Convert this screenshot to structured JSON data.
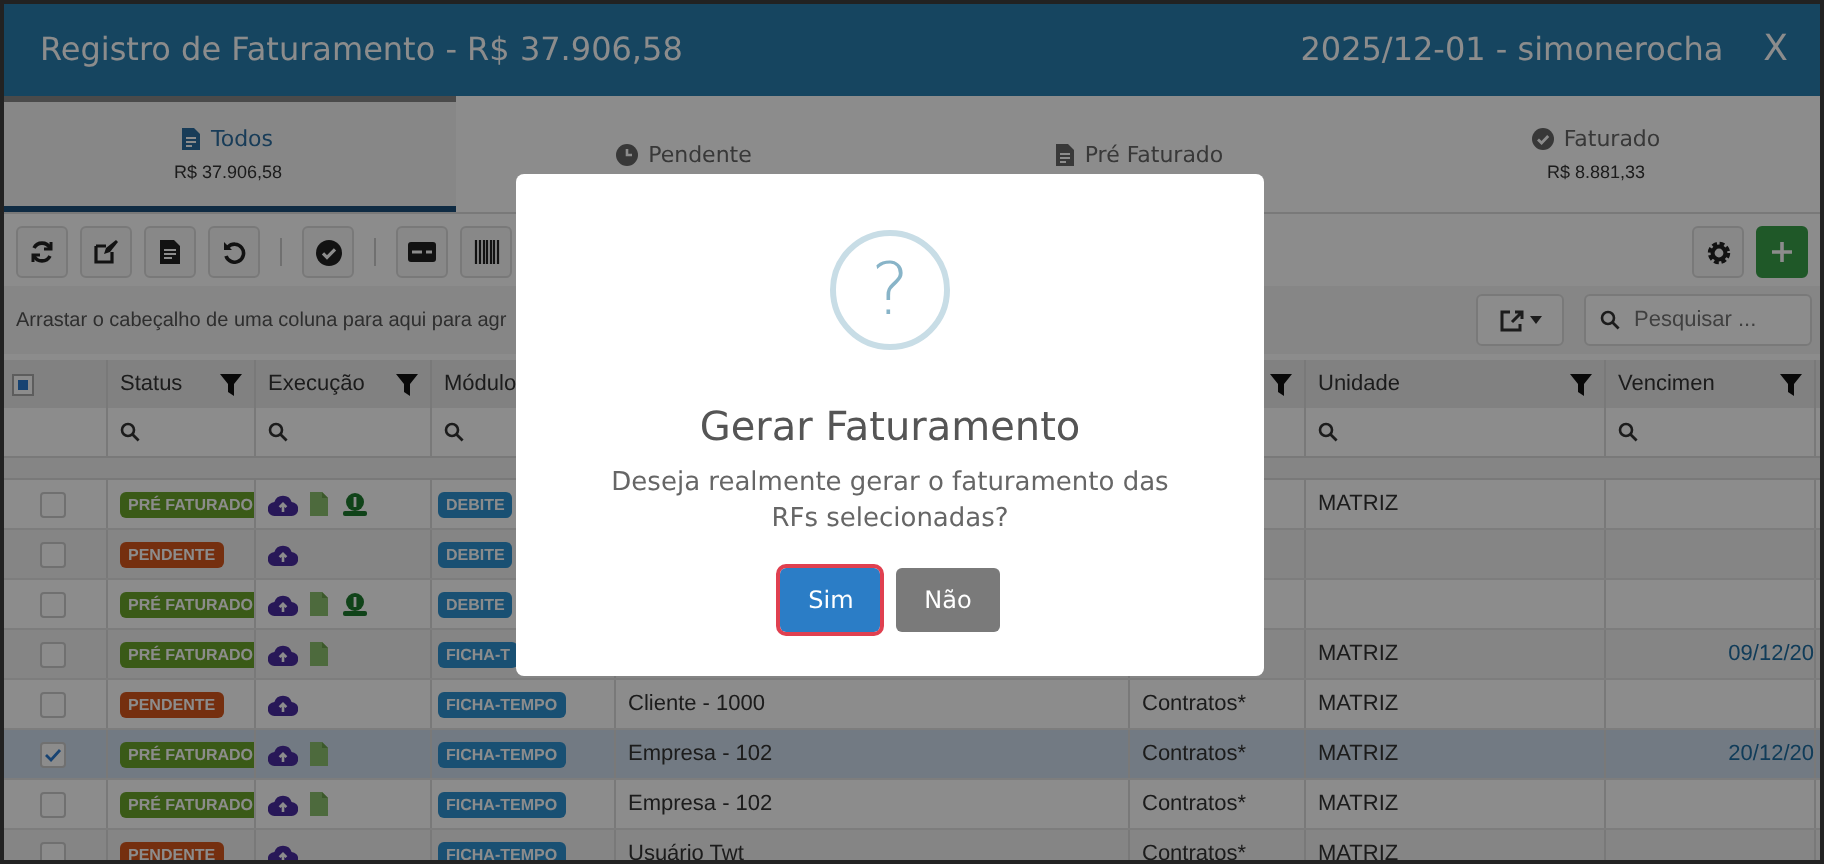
{
  "window": {
    "title": "Registro de Faturamento - R$ 37.906,58",
    "session": "2025/12-01 - simonerocha",
    "close": "X"
  },
  "tabs": [
    {
      "label": "Todos",
      "amount": "R$ 37.906,58",
      "kind": "file",
      "selected": true
    },
    {
      "label": "Pendente",
      "kind": "clock",
      "selected": false
    },
    {
      "label": "Pré Faturado",
      "kind": "file",
      "selected": false
    },
    {
      "label": "Faturado",
      "amount": "R$ 8.881,33",
      "kind": "check",
      "selected": false
    }
  ],
  "group_hint": "Arrastar o cabeçalho de uma coluna para aqui para agr",
  "search": {
    "placeholder": "Pesquisar ..."
  },
  "table": {
    "select_all_partial": true,
    "columns": [
      {
        "label": "Status",
        "filter": true,
        "search": true
      },
      {
        "label": "Execução",
        "filter": true,
        "search": true
      },
      {
        "label": "Módulo",
        "search": true
      },
      {},
      {
        "filter": true
      },
      {
        "label": "Unidade",
        "filter": true,
        "search": true
      },
      {
        "label": "Vencimen",
        "filter": true,
        "search": true
      }
    ],
    "rows": [
      {
        "checked": false,
        "selected": false,
        "status": {
          "label": "PRÉ FATURADO",
          "kind": "pre"
        },
        "execution": [
          {
            "kind": "cloud"
          },
          {
            "kind": "pdf"
          },
          {
            "kind": "money"
          }
        ],
        "module": "DEBITE",
        "unit": "MATRIZ"
      },
      {
        "checked": false,
        "selected": false,
        "status": {
          "label": "PENDENTE",
          "kind": "pending"
        },
        "execution": [
          {
            "kind": "cloud"
          }
        ],
        "module": "DEBITE"
      },
      {
        "checked": false,
        "selected": false,
        "status": {
          "label": "PRÉ FATURADO",
          "kind": "pre"
        },
        "execution": [
          {
            "kind": "cloud"
          },
          {
            "kind": "pdf"
          },
          {
            "kind": "money"
          }
        ],
        "module": "DEBITE"
      },
      {
        "checked": false,
        "selected": false,
        "status": {
          "label": "PRÉ FATURADO",
          "kind": "pre"
        },
        "execution": [
          {
            "kind": "cloud"
          },
          {
            "kind": "pdf"
          }
        ],
        "module": "FICHA-T",
        "unit": "MATRIZ",
        "due": "09/12/20"
      },
      {
        "checked": false,
        "selected": false,
        "status": {
          "label": "PENDENTE",
          "kind": "pending"
        },
        "execution": [
          {
            "kind": "cloud"
          }
        ],
        "module": "FICHA-TEMPO",
        "client": "Cliente - 1000",
        "type": "Contratos*",
        "unit": "MATRIZ"
      },
      {
        "checked": true,
        "selected": true,
        "status": {
          "label": "PRÉ FATURADO",
          "kind": "pre"
        },
        "execution": [
          {
            "kind": "cloud"
          },
          {
            "kind": "pdf"
          }
        ],
        "module": "FICHA-TEMPO",
        "client": "Empresa - 102",
        "type": "Contratos*",
        "unit": "MATRIZ",
        "due": "20/12/20"
      },
      {
        "checked": false,
        "selected": false,
        "status": {
          "label": "PRÉ FATURADO",
          "kind": "pre"
        },
        "execution": [
          {
            "kind": "cloud"
          },
          {
            "kind": "pdf"
          }
        ],
        "module": "FICHA-TEMPO",
        "client": "Empresa - 102",
        "type": "Contratos*",
        "unit": "MATRIZ"
      },
      {
        "checked": false,
        "selected": false,
        "status": {
          "label": "PENDENTE",
          "kind": "pending"
        },
        "execution": [
          {
            "kind": "cloud"
          }
        ],
        "module": "FICHA-TEMPO",
        "client": "Usuário Twt",
        "type": "Contratos*",
        "unit": "MATRIZ"
      }
    ]
  },
  "dialog": {
    "icon": "?",
    "title": "Gerar Faturamento",
    "message": "Deseja realmente gerar o faturamento das RFs selecionadas?",
    "buttons": [
      {
        "label": "Sim",
        "kind": "primary",
        "focused": true
      },
      {
        "label": "Não",
        "kind": "secondary",
        "focused": false
      }
    ]
  }
}
